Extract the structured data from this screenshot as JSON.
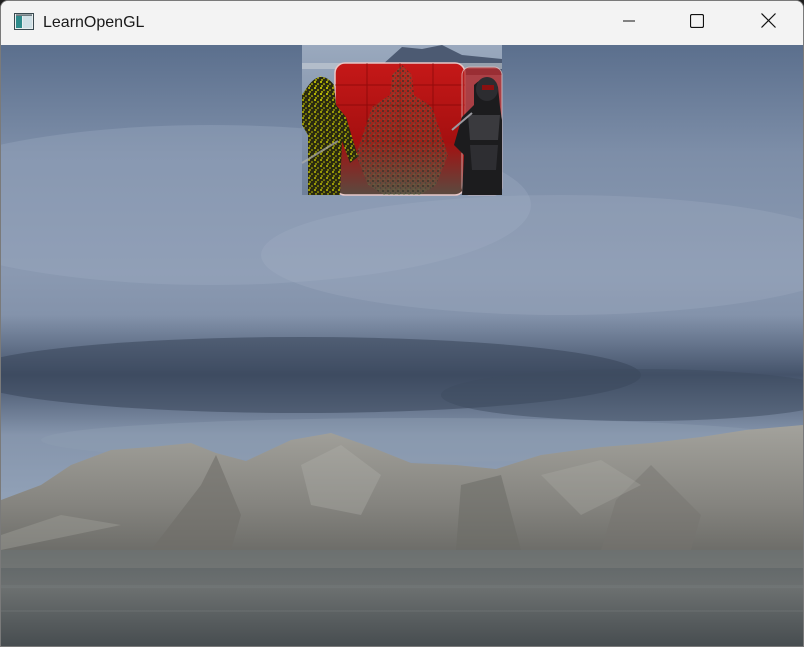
{
  "window": {
    "title": "LearnOpenGL",
    "controls": {
      "minimize_icon": "minimize-icon",
      "maximize_icon": "maximize-icon",
      "close_icon": "close-icon"
    }
  },
  "scene": {
    "background": "skybox-mountains-lake",
    "inset_view": "framebuffer-mirror-nanosuits",
    "colors": {
      "sky_top": "#5d7190",
      "sky_mid": "#8797b0",
      "cloud_band": "#3e4c62",
      "mountains": "#8a8984",
      "water": "#4f5557",
      "inset_red": "#b01010",
      "outline_yellow": "#e8e000"
    }
  }
}
